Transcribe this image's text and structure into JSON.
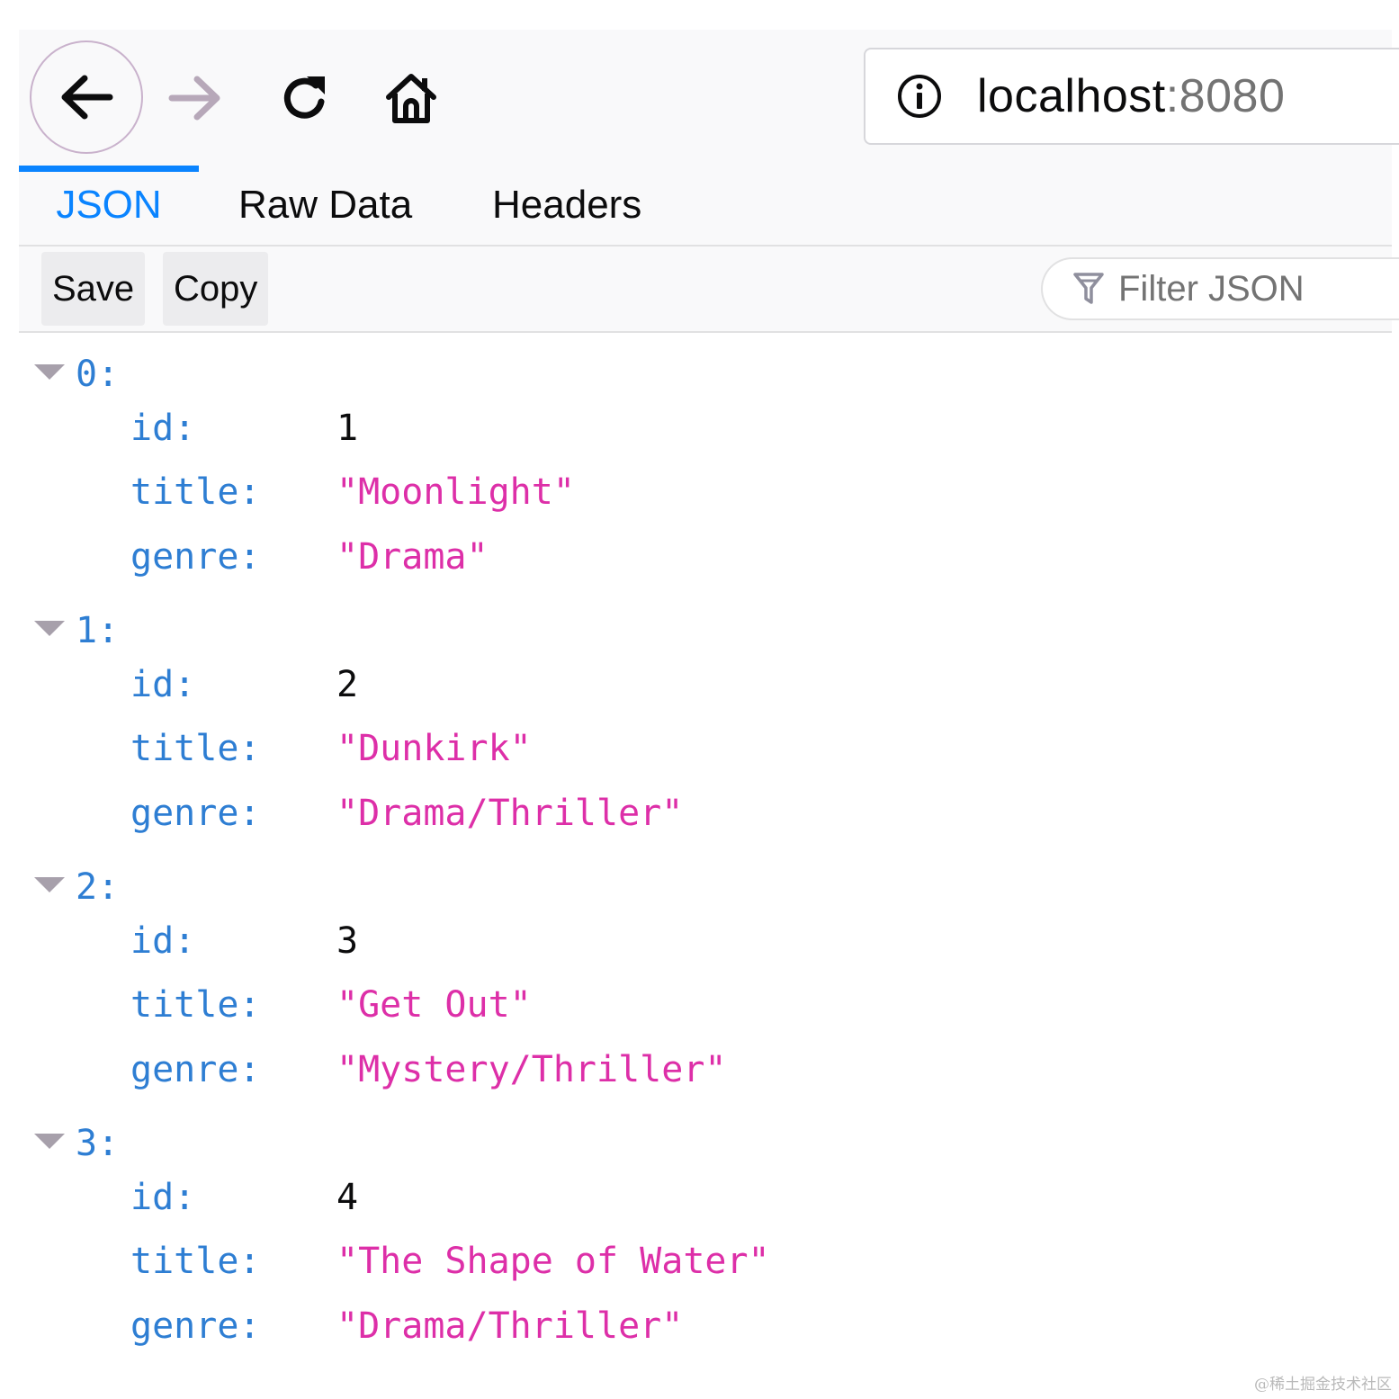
{
  "toolbar": {
    "back_icon": "arrow-left-icon",
    "forward_icon": "arrow-right-icon",
    "reload_icon": "reload-icon",
    "home_icon": "home-icon",
    "url_host": "localhost",
    "url_port": ":8080",
    "site_info_icon": "info-icon"
  },
  "tabs": [
    {
      "label": "JSON",
      "active": true
    },
    {
      "label": "Raw Data",
      "active": false
    },
    {
      "label": "Headers",
      "active": false
    }
  ],
  "actions": {
    "save_label": "Save",
    "copy_label": "Copy",
    "filter_placeholder": "Filter JSON",
    "filter_icon": "filter-icon"
  },
  "json": [
    {
      "index": "0:",
      "id": "1",
      "title": "\"Moonlight\"",
      "genre": "\"Drama\""
    },
    {
      "index": "1:",
      "id": "2",
      "title": "\"Dunkirk\"",
      "genre": "\"Drama/Thriller\""
    },
    {
      "index": "2:",
      "id": "3",
      "title": "\"Get Out\"",
      "genre": "\"Mystery/Thriller\""
    },
    {
      "index": "3:",
      "id": "4",
      "title": "\"The Shape of Water\"",
      "genre": "\"Drama/Thriller\""
    }
  ],
  "keys": {
    "id": "id:",
    "title": "title:",
    "genre": "genre:"
  },
  "watermark": "@稀土掘金技术社区",
  "colors": {
    "accent": "#0a84ff",
    "key": "#2e7ed3",
    "string": "#dd2fa8",
    "number": "#0c0c0d",
    "twisty": "#a7a0ab"
  }
}
